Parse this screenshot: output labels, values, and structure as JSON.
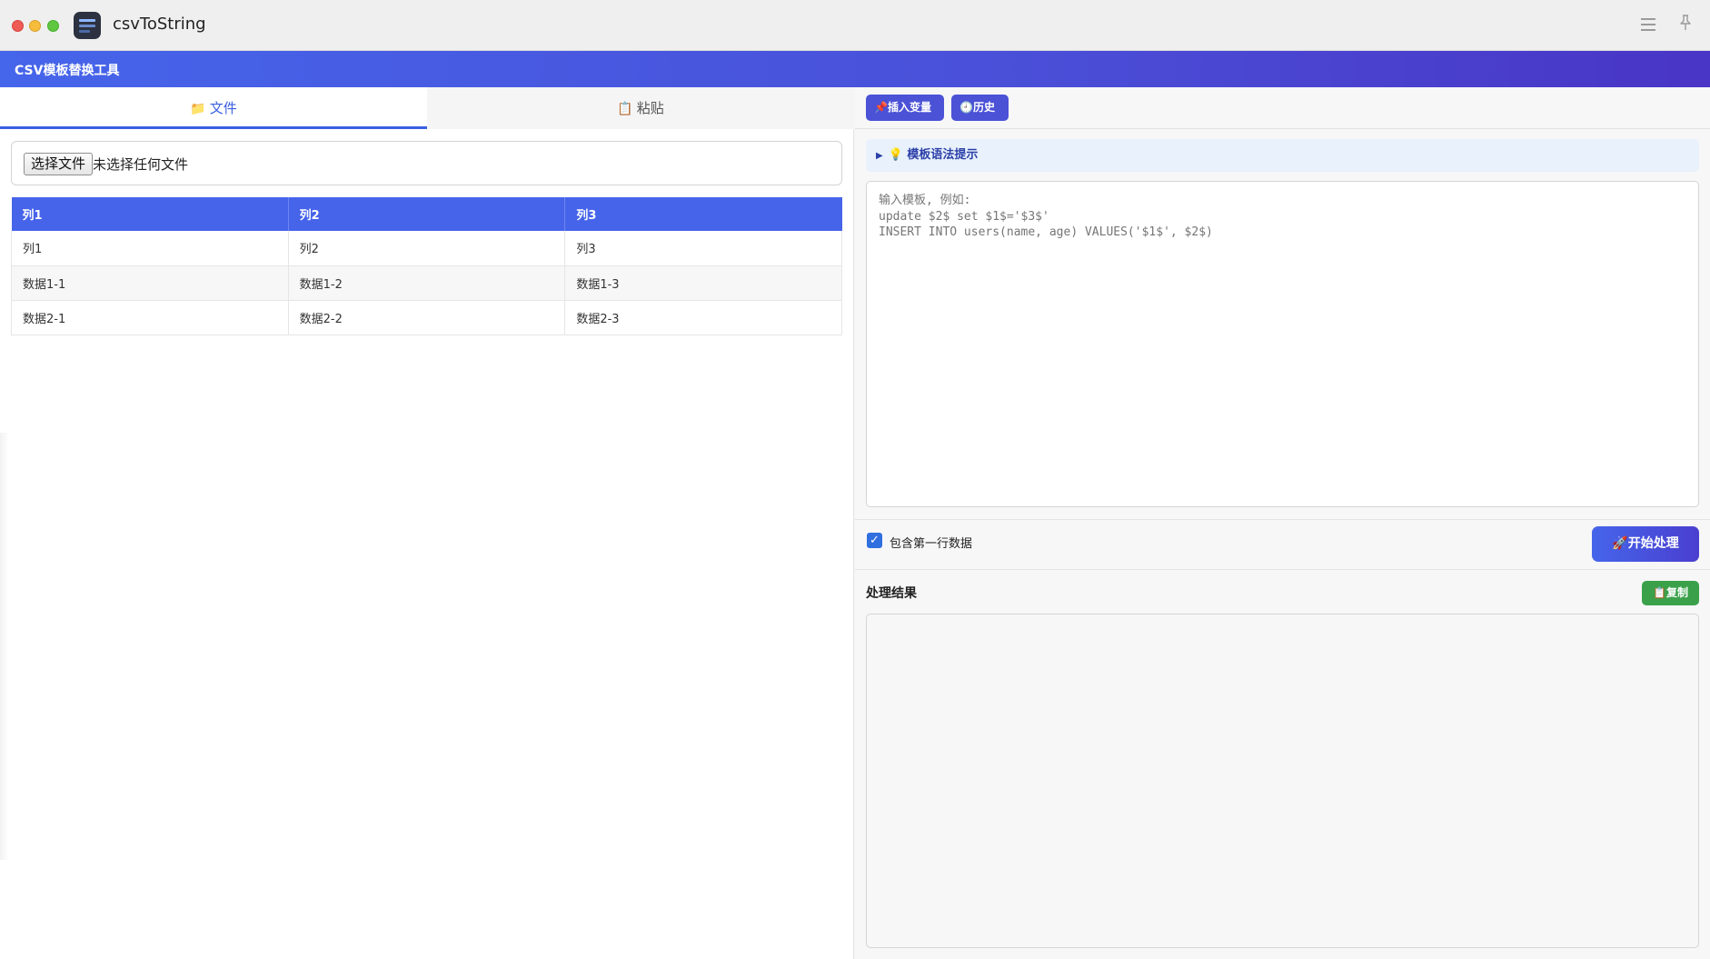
{
  "window": {
    "app_title": "csvToString",
    "app_icon": "spreadsheet-app-icon",
    "menu_icon": "hamburger-menu-icon",
    "pin_icon": "pin-icon"
  },
  "header": {
    "title": "CSV模板替换工具",
    "accent_color": "#4565ea"
  },
  "left": {
    "tabs": [
      {
        "label": "文件",
        "icon": "folder-icon",
        "active": true
      },
      {
        "label": "粘贴",
        "icon": "clipboard-icon",
        "active": false
      }
    ],
    "file_input": {
      "button_label": "选择文件",
      "status": "未选择任何文件"
    },
    "table": {
      "headers": [
        "列1",
        "列2",
        "列3"
      ],
      "rows": [
        [
          "列1",
          "列2",
          "列3"
        ],
        [
          "数据1-1",
          "数据1-2",
          "数据1-3"
        ],
        [
          "数据2-1",
          "数据2-2",
          "数据2-3"
        ]
      ]
    }
  },
  "right": {
    "toolbar": {
      "insert_label": "插入变量",
      "insert_icon": "pin-icon",
      "history_label": "历史",
      "history_icon": "clock-icon"
    },
    "hint": {
      "label": "模板语法提示",
      "icon": "lightbulb-icon"
    },
    "template": {
      "placeholder": "输入模板, 例如:\nupdate $2$ set $1$='$3$'\nINSERT INTO users(name, age) VALUES('$1$', $2$)",
      "value": ""
    },
    "options": {
      "include_first_row_label": "包含第一行数据",
      "include_first_row_checked": true
    },
    "start_button": {
      "label": "开始处理",
      "icon": "rocket-icon"
    },
    "result": {
      "label": "处理结果",
      "copy_label": "复制",
      "copy_icon": "clipboard-icon",
      "copy_color": "#3aa14a",
      "value": ""
    }
  }
}
